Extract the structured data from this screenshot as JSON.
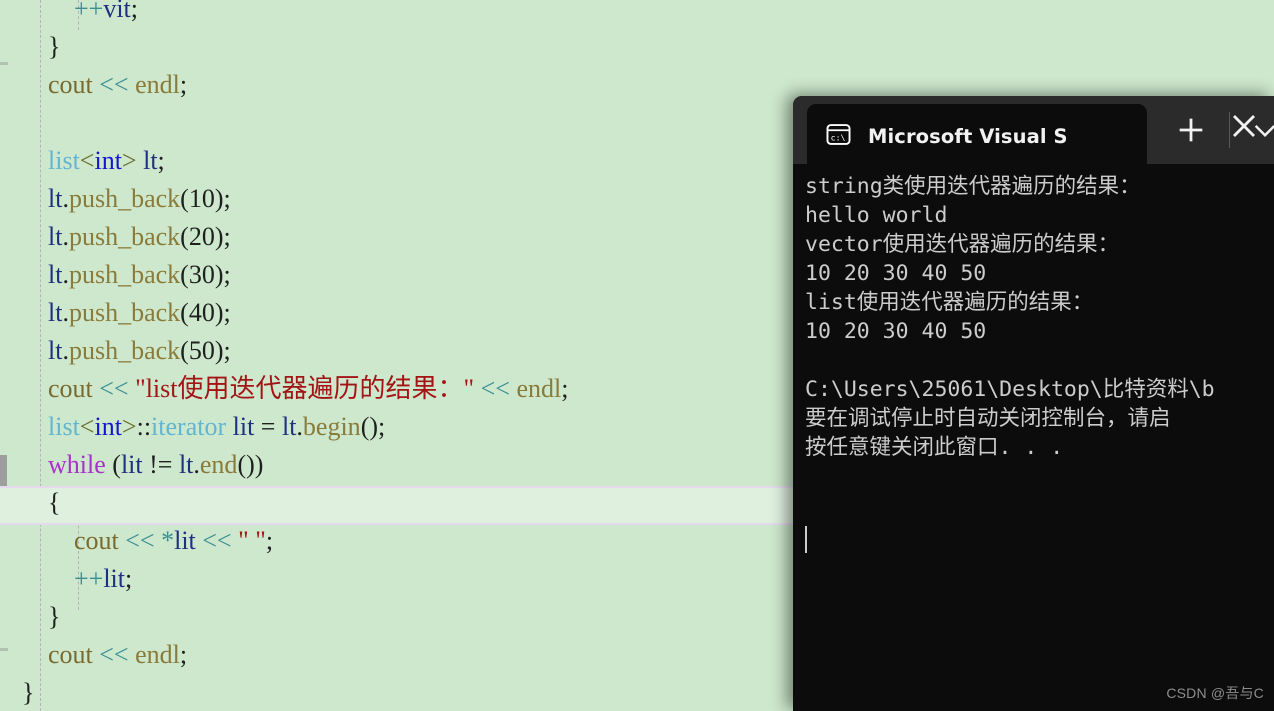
{
  "editor": {
    "background_color": "#cde8cd",
    "current_line_index": 13,
    "lines": [
      {
        "indent": 0,
        "tokens": [
          {
            "t": "        ",
            "c": "t-plain"
          },
          {
            "t": "++",
            "c": "t-op"
          },
          {
            "t": "vit",
            "c": "t-ident"
          },
          {
            "t": ";",
            "c": "t-punct"
          }
        ]
      },
      {
        "indent": 0,
        "tokens": [
          {
            "t": "    }",
            "c": "t-plain"
          }
        ]
      },
      {
        "indent": 0,
        "tokens": [
          {
            "t": "    cout ",
            "c": "t-obj"
          },
          {
            "t": "<<",
            "c": "t-op"
          },
          {
            "t": " endl",
            "c": "t-mem"
          },
          {
            "t": ";",
            "c": "t-punct"
          }
        ]
      },
      {
        "indent": 0,
        "tokens": [
          {
            "t": " ",
            "c": "t-plain"
          }
        ]
      },
      {
        "indent": 0,
        "tokens": [
          {
            "t": "    ",
            "c": "t-plain"
          },
          {
            "t": "list",
            "c": "t-class"
          },
          {
            "t": "<",
            "c": "t-angle"
          },
          {
            "t": "int",
            "c": "t-kw"
          },
          {
            "t": ">",
            "c": "t-angle"
          },
          {
            "t": " lt",
            "c": "t-ident"
          },
          {
            "t": ";",
            "c": "t-punct"
          }
        ]
      },
      {
        "indent": 0,
        "tokens": [
          {
            "t": "    ",
            "c": "t-plain"
          },
          {
            "t": "lt",
            "c": "t-ident"
          },
          {
            "t": ".",
            "c": "t-punct"
          },
          {
            "t": "push_back",
            "c": "t-mem"
          },
          {
            "t": "(",
            "c": "t-punct"
          },
          {
            "t": "10",
            "c": "t-plain"
          },
          {
            "t": ");",
            "c": "t-punct"
          }
        ]
      },
      {
        "indent": 0,
        "tokens": [
          {
            "t": "    ",
            "c": "t-plain"
          },
          {
            "t": "lt",
            "c": "t-ident"
          },
          {
            "t": ".",
            "c": "t-punct"
          },
          {
            "t": "push_back",
            "c": "t-mem"
          },
          {
            "t": "(",
            "c": "t-punct"
          },
          {
            "t": "20",
            "c": "t-plain"
          },
          {
            "t": ");",
            "c": "t-punct"
          }
        ]
      },
      {
        "indent": 0,
        "tokens": [
          {
            "t": "    ",
            "c": "t-plain"
          },
          {
            "t": "lt",
            "c": "t-ident"
          },
          {
            "t": ".",
            "c": "t-punct"
          },
          {
            "t": "push_back",
            "c": "t-mem"
          },
          {
            "t": "(",
            "c": "t-punct"
          },
          {
            "t": "30",
            "c": "t-plain"
          },
          {
            "t": ");",
            "c": "t-punct"
          }
        ]
      },
      {
        "indent": 0,
        "tokens": [
          {
            "t": "    ",
            "c": "t-plain"
          },
          {
            "t": "lt",
            "c": "t-ident"
          },
          {
            "t": ".",
            "c": "t-punct"
          },
          {
            "t": "push_back",
            "c": "t-mem"
          },
          {
            "t": "(",
            "c": "t-punct"
          },
          {
            "t": "40",
            "c": "t-plain"
          },
          {
            "t": ");",
            "c": "t-punct"
          }
        ]
      },
      {
        "indent": 0,
        "tokens": [
          {
            "t": "    ",
            "c": "t-plain"
          },
          {
            "t": "lt",
            "c": "t-ident"
          },
          {
            "t": ".",
            "c": "t-punct"
          },
          {
            "t": "push_back",
            "c": "t-mem"
          },
          {
            "t": "(",
            "c": "t-punct"
          },
          {
            "t": "50",
            "c": "t-plain"
          },
          {
            "t": ");",
            "c": "t-punct"
          }
        ]
      },
      {
        "indent": 0,
        "tokens": [
          {
            "t": "    cout ",
            "c": "t-obj"
          },
          {
            "t": "<<",
            "c": "t-op"
          },
          {
            "t": " \"list使用迭代器遍历的结果：\"",
            "c": "t-str"
          },
          {
            "t": " ",
            "c": "t-plain"
          },
          {
            "t": "<<",
            "c": "t-op"
          },
          {
            "t": " endl",
            "c": "t-mem"
          },
          {
            "t": ";",
            "c": "t-punct"
          }
        ]
      },
      {
        "indent": 0,
        "tokens": [
          {
            "t": "    ",
            "c": "t-plain"
          },
          {
            "t": "list",
            "c": "t-class"
          },
          {
            "t": "<",
            "c": "t-angle"
          },
          {
            "t": "int",
            "c": "t-kw"
          },
          {
            "t": ">",
            "c": "t-angle"
          },
          {
            "t": "::",
            "c": "t-punct"
          },
          {
            "t": "iterator",
            "c": "t-class"
          },
          {
            "t": " lit",
            "c": "t-ident"
          },
          {
            "t": " = ",
            "c": "t-punct"
          },
          {
            "t": "lt",
            "c": "t-ident"
          },
          {
            "t": ".",
            "c": "t-punct"
          },
          {
            "t": "begin",
            "c": "t-mem"
          },
          {
            "t": "();",
            "c": "t-punct"
          }
        ]
      },
      {
        "indent": 0,
        "tokens": [
          {
            "t": "    ",
            "c": "t-plain"
          },
          {
            "t": "while",
            "c": "t-kwctl"
          },
          {
            "t": " (",
            "c": "t-punct"
          },
          {
            "t": "lit",
            "c": "t-ident"
          },
          {
            "t": " ",
            "c": "t-plain"
          },
          {
            "t": "!=",
            "c": "t-punct"
          },
          {
            "t": " ",
            "c": "t-plain"
          },
          {
            "t": "lt",
            "c": "t-ident"
          },
          {
            "t": ".",
            "c": "t-punct"
          },
          {
            "t": "end",
            "c": "t-mem"
          },
          {
            "t": "())",
            "c": "t-punct"
          }
        ]
      },
      {
        "indent": 0,
        "tokens": [
          {
            "t": "    {",
            "c": "t-plain"
          }
        ]
      },
      {
        "indent": 0,
        "tokens": [
          {
            "t": "        cout ",
            "c": "t-obj"
          },
          {
            "t": "<<",
            "c": "t-op"
          },
          {
            "t": " ",
            "c": "t-plain"
          },
          {
            "t": "*",
            "c": "t-op"
          },
          {
            "t": "lit",
            "c": "t-ident"
          },
          {
            "t": " ",
            "c": "t-plain"
          },
          {
            "t": "<<",
            "c": "t-op"
          },
          {
            "t": " \" \"",
            "c": "t-str"
          },
          {
            "t": ";",
            "c": "t-punct"
          }
        ]
      },
      {
        "indent": 0,
        "tokens": [
          {
            "t": "        ",
            "c": "t-plain"
          },
          {
            "t": "++",
            "c": "t-op"
          },
          {
            "t": "lit",
            "c": "t-ident"
          },
          {
            "t": ";",
            "c": "t-punct"
          }
        ]
      },
      {
        "indent": 0,
        "tokens": [
          {
            "t": "    }",
            "c": "t-plain"
          }
        ]
      },
      {
        "indent": 0,
        "tokens": [
          {
            "t": "    cout ",
            "c": "t-obj"
          },
          {
            "t": "<<",
            "c": "t-op"
          },
          {
            "t": " endl",
            "c": "t-mem"
          },
          {
            "t": ";",
            "c": "t-punct"
          }
        ]
      },
      {
        "indent": 0,
        "tokens": [
          {
            "t": "}",
            "c": "t-plain"
          }
        ]
      }
    ]
  },
  "terminal": {
    "tab_title": "Microsoft Visual Studio 调试控",
    "tab_icon": "console-cmd-icon",
    "close_label": "×",
    "new_tab_label": "+",
    "dropdown_label": "⌄",
    "output_lines": [
      "string类使用迭代器遍历的结果：",
      "hello world",
      "vector使用迭代器遍历的结果：",
      "10 20 30 40 50",
      "list使用迭代器遍历的结果：",
      "10 20 30 40 50",
      "",
      "C:\\Users\\25061\\Desktop\\比特资料\\b",
      "要在调试停止时自动关闭控制台，请启",
      "按任意键关闭此窗口. . ."
    ]
  },
  "watermark": {
    "text": "CSDN @吾与C"
  }
}
